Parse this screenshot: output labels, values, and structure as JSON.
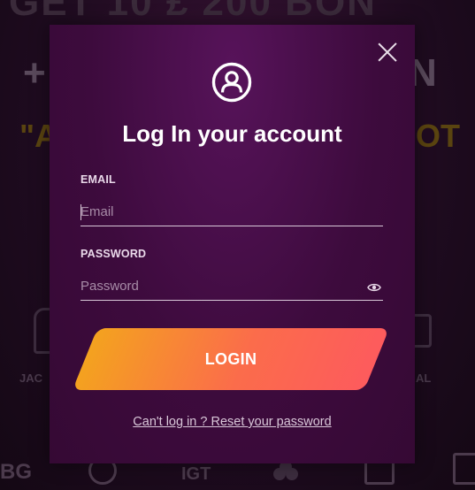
{
  "background": {
    "headline_partial": "GET 10 £ 200 BON",
    "plus_partial": "+",
    "n_partial": "N",
    "quote_partial": "\"A",
    "t_partial": "OT",
    "left_caption_partial": "JAC",
    "right_caption_partial": "AL",
    "provider_logos": [
      "BG",
      "IGT"
    ]
  },
  "modal": {
    "icon": "user-circle-icon",
    "close_icon": "close-icon",
    "title": "Log In your account",
    "email": {
      "label": "EMAIL",
      "placeholder": "Email",
      "value": ""
    },
    "password": {
      "label": "PASSWORD",
      "placeholder": "Password",
      "value": "",
      "toggle_icon": "eye-icon"
    },
    "login_label": "LOGIN",
    "reset_link": "Can't log in ? Reset your password"
  },
  "colors": {
    "modal_bg": "#3d0b3d",
    "button_gradient_start": "#f4a21f",
    "button_gradient_end": "#fd5b5d",
    "page_bg": "#1c0a1d"
  }
}
